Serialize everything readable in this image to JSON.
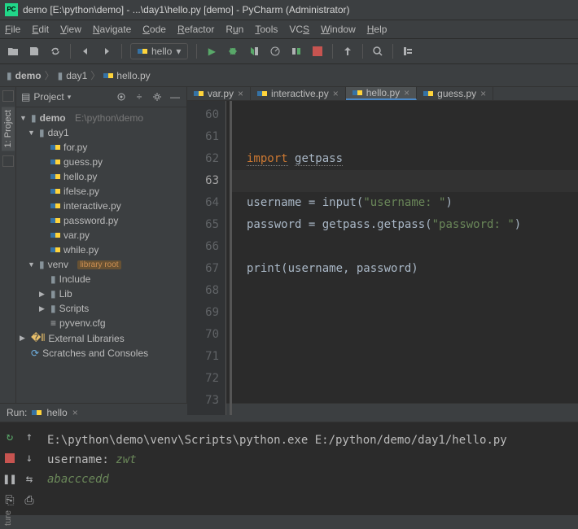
{
  "title": "demo [E:\\python\\demo] - ...\\day1\\hello.py [demo] - PyCharm (Administrator)",
  "menubar": [
    "File",
    "Edit",
    "View",
    "Navigate",
    "Code",
    "Refactor",
    "Run",
    "Tools",
    "VCS",
    "Window",
    "Help"
  ],
  "run_config": "hello",
  "breadcrumb": {
    "project": "demo",
    "folder": "day1",
    "file": "hello.py"
  },
  "project_view": {
    "title": "Project",
    "root": {
      "name": "demo",
      "path": "E:\\python\\demo"
    },
    "day1": "day1",
    "files": [
      "for.py",
      "guess.py",
      "hello.py",
      "ifelse.py",
      "interactive.py",
      "password.py",
      "var.py",
      "while.py"
    ],
    "venv": {
      "name": "venv",
      "tag": "library root",
      "children": [
        "Include",
        "Lib",
        "Scripts"
      ],
      "cfg": "pyvenv.cfg"
    },
    "ext_lib": "External Libraries",
    "scratches": "Scratches and Consoles"
  },
  "tabs": [
    {
      "label": "var.py",
      "active": false
    },
    {
      "label": "interactive.py",
      "active": false
    },
    {
      "label": "hello.py",
      "active": true
    },
    {
      "label": "guess.py",
      "active": false
    }
  ],
  "gutter": [
    "60",
    "61",
    "62",
    "63",
    "64",
    "65",
    "66",
    "67",
    "68",
    "69",
    "70",
    "71",
    "72",
    "73"
  ],
  "code": {
    "l62_import": "import",
    "l62_mod": "getpass",
    "l64_var": "username = ",
    "l64_fn": "input",
    "l64_str": "\"username: \"",
    "l65_var": "password = getpass.",
    "l65_fn": "getpass",
    "l65_str": "\"password: \"",
    "l67_fn": "print",
    "l67_args": "(username, password)"
  },
  "run": {
    "label": "Run:",
    "name": "hello",
    "out1": "E:\\python\\demo\\venv\\Scripts\\python.exe E:/python/demo/day1/hello.py",
    "out2a": "username: ",
    "out2b": "zwt",
    "out3": "abacccedd"
  },
  "bottom_tab": "ture"
}
